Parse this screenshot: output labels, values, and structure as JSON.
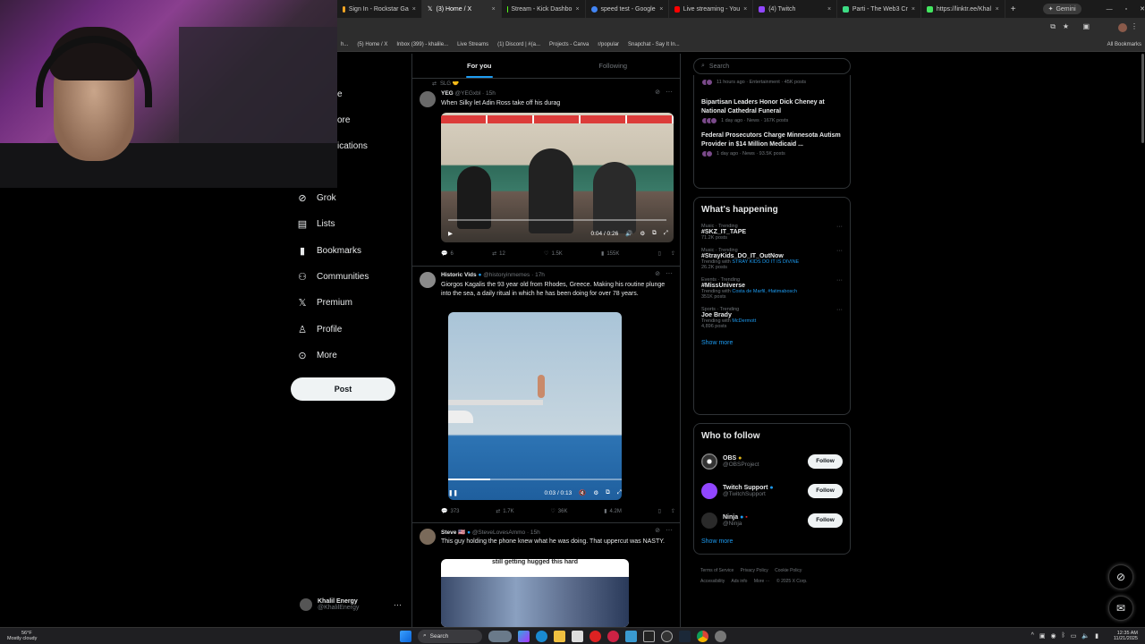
{
  "browser": {
    "tabs": [
      {
        "label": "Sign In - Rockstar Ga",
        "color": "#f5a623",
        "active": false
      },
      {
        "label": "(3) Home / X",
        "color": "#ffffff",
        "active": true
      },
      {
        "label": "Stream - Kick Dashbo",
        "color": "#53fc18",
        "active": false
      },
      {
        "label": "speed test - Google",
        "color": "#4285f4",
        "active": false
      },
      {
        "label": "Live streaming - You",
        "color": "#ff0000",
        "active": false
      },
      {
        "label": "(4) Twitch",
        "color": "#9146ff",
        "active": false
      },
      {
        "label": "Parti - The Web3 Cr",
        "color": "#3ddc84",
        "active": false
      },
      {
        "label": "https://linktr.ee/Khal",
        "color": "#43e660",
        "active": false
      }
    ],
    "gemini_label": "Gemini",
    "bookmarks": [
      "(5) Home / X",
      "Inbox (399) - khalile...",
      "Live Streams",
      "(1) Discord | #(a...",
      "Projects - Canva",
      "r/popular",
      "Snapchat - Say It In..."
    ],
    "all_bookmarks": "All Bookmarks"
  },
  "sidenav": {
    "partial_items": [
      "e",
      "ore",
      "ications"
    ],
    "items": [
      {
        "label": "Grok",
        "icon": "grok-icon",
        "glyph": "⊘"
      },
      {
        "label": "Lists",
        "icon": "lists-icon",
        "glyph": "▤"
      },
      {
        "label": "Bookmarks",
        "icon": "bookmark-icon",
        "glyph": "▮"
      },
      {
        "label": "Communities",
        "icon": "communities-icon",
        "glyph": "⚇"
      },
      {
        "label": "Premium",
        "icon": "x-logo-icon",
        "glyph": "𝕏"
      },
      {
        "label": "Profile",
        "icon": "profile-icon",
        "glyph": "♙"
      },
      {
        "label": "More",
        "icon": "more-circle-icon",
        "glyph": "⊙"
      }
    ],
    "post_label": "Post",
    "account": {
      "name": "Khalil Energy",
      "handle": "@KhalilEnergy",
      "more": "···"
    }
  },
  "feed": {
    "tabs": [
      "For you",
      "Following"
    ],
    "tweets": [
      {
        "context": "SLG 🤝",
        "name": "YEG",
        "handle": "@YEGxbl · 15h",
        "text": "When Silky let Adin Ross take off his durag",
        "video_time": "0:04 / 0:26",
        "replies": "6",
        "reposts": "12",
        "likes": "1.5K",
        "views": "155K"
      },
      {
        "name": "Historic Vids",
        "handle": "@historyinmemes · 17h",
        "text": "Giorgos Kagalis the 93 year old from Rhodes, Greece. Making his routine plunge into the sea, a daily ritual in which he has been doing for over 78 years.",
        "video_time": "0:03 / 0:13",
        "replies": "373",
        "reposts": "1.7K",
        "likes": "36K",
        "views": "4.2M"
      },
      {
        "name": "Steve 🇺🇸",
        "handle": "@SteveLovesAmmo · 15h",
        "text": "This guy holding the phone knew what he was doing. That uppercut was NASTY.",
        "caption": "still getting hugged this hard"
      }
    ]
  },
  "right": {
    "search_placeholder": "Search",
    "news": [
      {
        "title": "",
        "meta": "11 hours ago · Entertainment · 45K posts"
      },
      {
        "title": "Bipartisan Leaders Honor Dick Cheney at National Cathedral Funeral",
        "meta": "1 day ago · News · 167K posts"
      },
      {
        "title": "Federal Prosecutors Charge Minnesota Autism Provider in $14 Million Medicaid ...",
        "meta": "1 day ago · News · 93.5K posts"
      }
    ],
    "happening_title": "What's happening",
    "trends": [
      {
        "meta": "Music · Trending",
        "title": "#SKZ_IT_TAPE",
        "sub": "71.2K posts",
        "with": ""
      },
      {
        "meta": "Music · Trending",
        "title": "#StrayKids_DO_IT_OutNow",
        "sub": "26.2K posts",
        "with": "STRAY KIDS DO IT IS DIVINE"
      },
      {
        "meta": "Events · Trending",
        "title": "#MissUniverse",
        "sub": "351K posts",
        "with": "Costa de Marfil, #fatimabosch"
      },
      {
        "meta": "Sports · Trending",
        "title": "Joe Brady",
        "sub": "4,896 posts",
        "with": "McDermott"
      }
    ],
    "trending_with": "Trending with",
    "show_more": "Show more",
    "wtf_title": "Who to follow",
    "wtf": [
      {
        "name": "OBS",
        "handle": "@OBSProject"
      },
      {
        "name": "Twitch Support",
        "handle": "@TwitchSupport"
      },
      {
        "name": "Ninja",
        "handle": "@Ninja"
      }
    ],
    "follow_label": "Follow",
    "footer": [
      "Terms of Service",
      "Privacy Policy",
      "Cookie Policy",
      "Accessibility",
      "Ads info",
      "More ···",
      "© 2025 X Corp."
    ]
  },
  "taskbar": {
    "weather_temp": "56°F",
    "weather_desc": "Mostly cloudy",
    "search_label": "Search",
    "time": "12:35 AM",
    "date": "11/21/2025"
  },
  "colors": {
    "accent": "#1d9bf0",
    "bg": "#000000",
    "text": "#e7e9ea",
    "muted": "#71767b"
  }
}
